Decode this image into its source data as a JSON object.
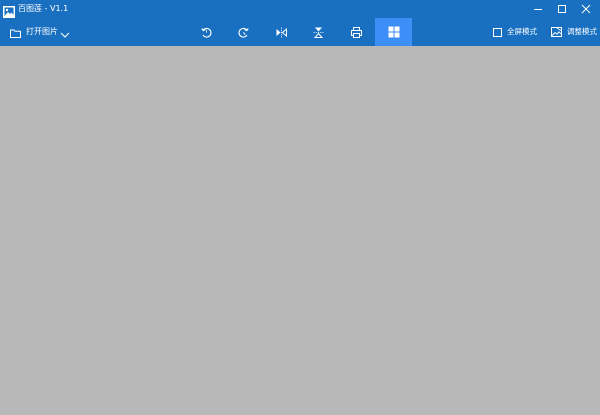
{
  "window": {
    "title": "百图莲 - V1.1",
    "title_icon": "image-icon",
    "controls": [
      "minimize-icon",
      "maximize-icon",
      "close-icon"
    ]
  },
  "toolbar": {
    "open_label": "打开图片",
    "open_icon": "folder-icon",
    "dropdown_icon": "chevron-down-icon",
    "tools": [
      {
        "name": "rotate-left-icon"
      },
      {
        "name": "rotate-right-icon"
      },
      {
        "name": "flip-horizontal-icon"
      },
      {
        "name": "flip-vertical-icon"
      },
      {
        "name": "print-icon"
      },
      {
        "name": "grid-icon",
        "active": true
      }
    ],
    "fullscreen_label": "全屏模式",
    "adjust_label": "调整模式"
  },
  "colors": {
    "titlebar": "#1a70c0",
    "active_tool": "#3d8ef6",
    "canvas": "#b8b8b8",
    "foreground": "#ffffff"
  }
}
